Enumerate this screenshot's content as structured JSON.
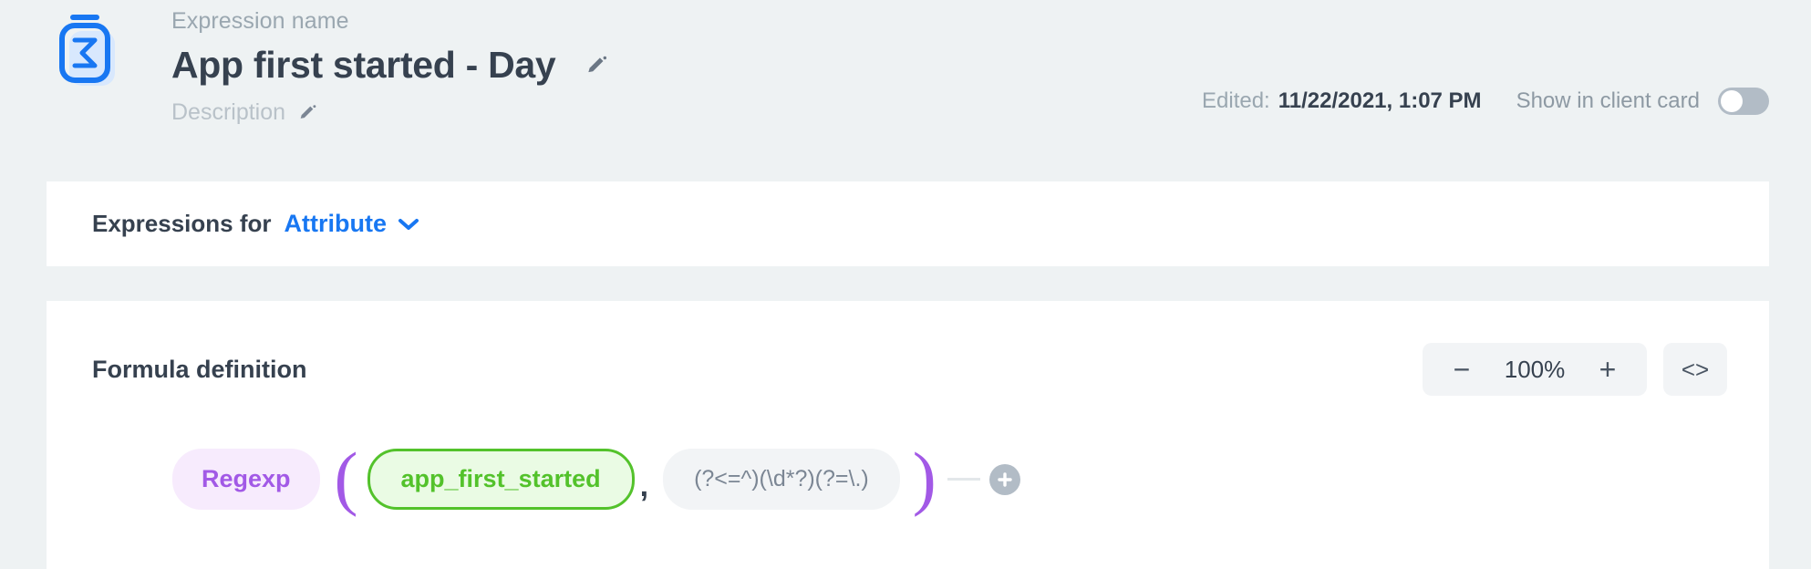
{
  "header": {
    "icon_name": "sigma-expression-icon",
    "expression_name_label": "Expression name",
    "title": "App first started - Day",
    "edit_title_icon": "pencil-icon",
    "description_placeholder": "Description",
    "edit_description_icon": "pencil-icon",
    "edited_label": "Edited:",
    "edited_value": "11/22/2021, 1:07 PM",
    "show_in_client_card_label": "Show in client card",
    "show_in_client_card_state": "off"
  },
  "expressions_for": {
    "label": "Expressions for",
    "selected": "Attribute",
    "chevron_icon": "chevron-down-icon"
  },
  "formula": {
    "title": "Formula definition",
    "zoom_out_label": "−",
    "zoom_level": "100%",
    "zoom_in_label": "+",
    "code_view_label": "<>",
    "tokens": {
      "function": "Regexp",
      "paren_open": "(",
      "field": "app_first_started",
      "comma": ",",
      "literal": "(?<=^)(\\d*?)(?=\\.)",
      "paren_close": ")"
    },
    "add_button_icon": "plus-icon"
  },
  "colors": {
    "page_background": "#eef2f3",
    "card_background": "#ffffff",
    "accent_blue": "#1877f2",
    "text_dark": "#36414f",
    "text_muted": "#9aa7b0",
    "function_purple": "#a259e6",
    "field_green": "#53c22b",
    "toggle_grey": "#b2bcc6"
  }
}
